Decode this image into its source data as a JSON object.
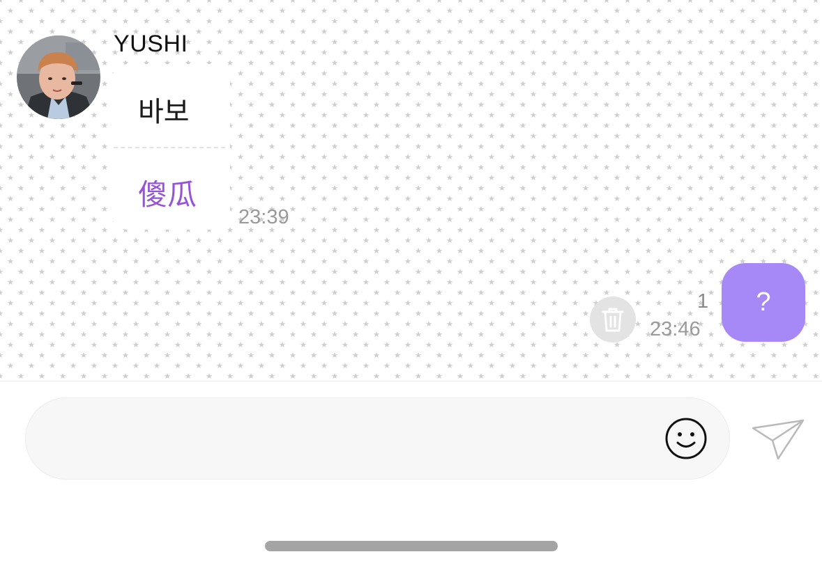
{
  "chat": {
    "incoming": {
      "sender_name": "YUSHI",
      "avatar": "profile-photo",
      "text": "바보",
      "translation": "傻瓜",
      "time": "23:39"
    },
    "outgoing": {
      "text": "?",
      "unread_count": "1",
      "time": "23:46",
      "delete_icon": "trash-icon"
    }
  },
  "composer": {
    "placeholder": "",
    "emoji_icon": "smiley-face-icon",
    "send_icon": "paper-plane-icon"
  },
  "colors": {
    "outgoing_bubble": "#a788f7",
    "translation_text": "#9554d8",
    "timestamp": "#9a9a9a"
  }
}
